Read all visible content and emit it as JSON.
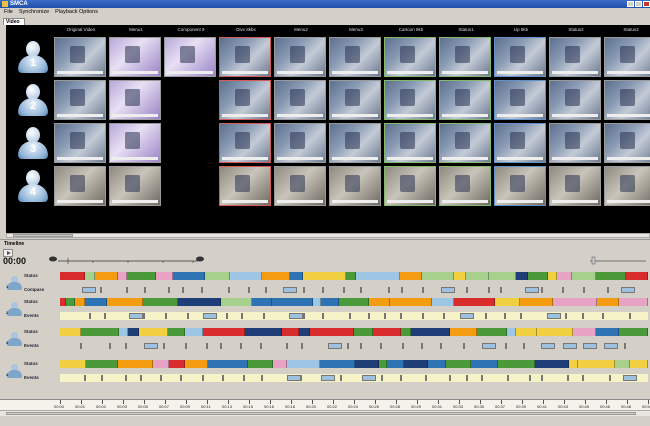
{
  "window": {
    "title": "SMCA"
  },
  "menu": [
    "File",
    "Synchronize",
    "Playback Options"
  ],
  "tabs": {
    "video": "Video"
  },
  "video": {
    "columns": [
      "Original Video",
      "Menu1",
      "Component 9",
      "Divx 8kbs",
      "Menu2",
      "Menu3",
      "Cartoon 8kb",
      "Status1",
      "Up 8kb",
      "Status2",
      "Status3"
    ],
    "participants": [
      "1",
      "2",
      "3",
      "4"
    ]
  },
  "timeline": {
    "label": "Timeline",
    "timecode": "00:00",
    "tracks": [
      {
        "id": "1",
        "status_label": "Status",
        "events_label": "Compass"
      },
      {
        "id": "2",
        "status_label": "Status",
        "events_label": "Events"
      },
      {
        "id": "3",
        "status_label": "Status",
        "events_label": "Events"
      },
      {
        "id": "4",
        "status_label": "Status",
        "events_label": "Events"
      }
    ],
    "ruler": [
      "00:00",
      "00:01",
      "00:02",
      "00:03",
      "00:05",
      "00:07",
      "00:09",
      "00:11",
      "00:13",
      "00:15",
      "00:16",
      "00:18",
      "00:20",
      "00:22",
      "00:24",
      "00:26",
      "00:28",
      "00:29",
      "00:31",
      "00:33",
      "00:35",
      "00:37",
      "00:39",
      "00:41",
      "00:43",
      "00:45",
      "00:46",
      "00:48",
      "00:50"
    ]
  },
  "colors": {
    "seg_blue": "#2e74b5",
    "seg_lightblue": "#9cc6e4",
    "seg_green": "#a8d08d",
    "seg_darkgreen": "#4a9a3a",
    "seg_orange": "#f39c12",
    "seg_red": "#d92d2d",
    "seg_navy": "#1f3e78",
    "seg_pink": "#e8a3c4",
    "seg_yellow": "#f0d040"
  }
}
